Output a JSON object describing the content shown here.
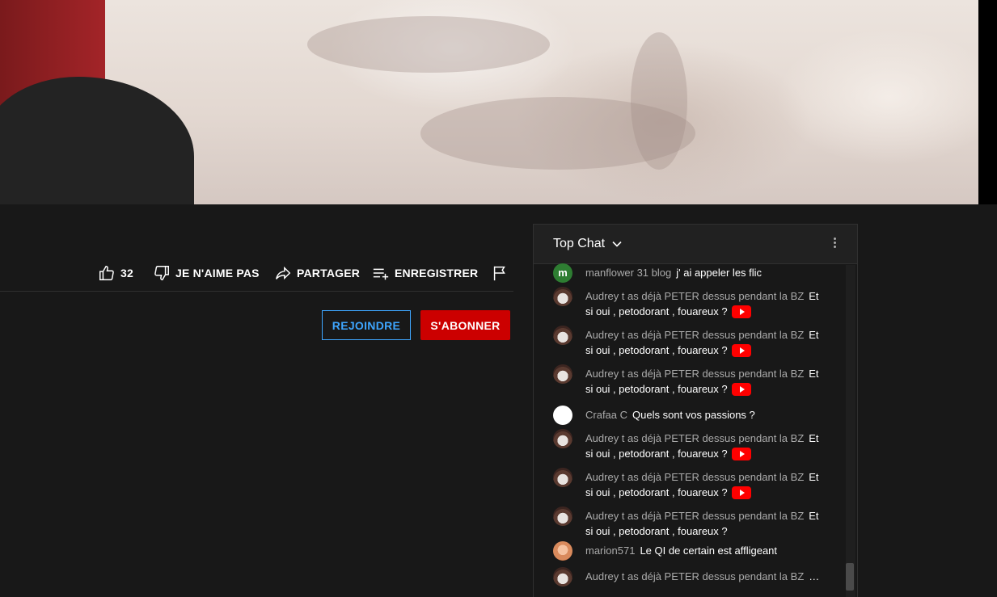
{
  "actions": {
    "like_count": "32",
    "dislike_label": "JE N'AIME PAS",
    "share_label": "PARTAGER",
    "save_label": "ENREGISTRER"
  },
  "channel": {
    "join_label": "REJOINDRE",
    "subscribe_label": "S'ABONNER"
  },
  "chat": {
    "title": "Top Chat",
    "messages": [
      {
        "author": "manflower 31 blog",
        "text": "j' ai appeler les flic",
        "avatar_letter": "m",
        "yt_icon": false
      },
      {
        "author": "Audrey t as déjà PETER dessus pendant la BZ",
        "text": "Et si oui , petodorant , fouareux ?",
        "yt_icon": true
      },
      {
        "author": "Audrey t as déjà PETER dessus pendant la BZ",
        "text": "Et si oui , petodorant , fouareux ?",
        "yt_icon": true
      },
      {
        "author": "Audrey t as déjà PETER dessus pendant la BZ",
        "text": "Et si oui , petodorant , fouareux ?",
        "yt_icon": true
      },
      {
        "author": "Crafaa C",
        "text": "Quels sont vos passions ?",
        "yt_icon": false
      },
      {
        "author": "Audrey t as déjà PETER dessus pendant la BZ",
        "text": "Et si oui , petodorant , fouareux ?",
        "yt_icon": true
      },
      {
        "author": "Audrey t as déjà PETER dessus pendant la BZ",
        "text": "Et si oui , petodorant , fouareux ?",
        "yt_icon": true
      },
      {
        "author": "Audrey t as déjà PETER dessus pendant la BZ",
        "text": "Et si oui , petodorant , fouareux ?",
        "yt_icon": false
      },
      {
        "author": "marion571",
        "text": "Le QI de certain est affligeant",
        "yt_icon": false
      },
      {
        "author": "Audrey t as déjà PETER dessus pendant la BZ",
        "text": "…",
        "yt_icon": false
      }
    ]
  },
  "colors": {
    "background": "#181818",
    "subscribe_red": "#cc0000",
    "join_blue": "#3ea6ff",
    "youtube_red": "#ff0000"
  }
}
